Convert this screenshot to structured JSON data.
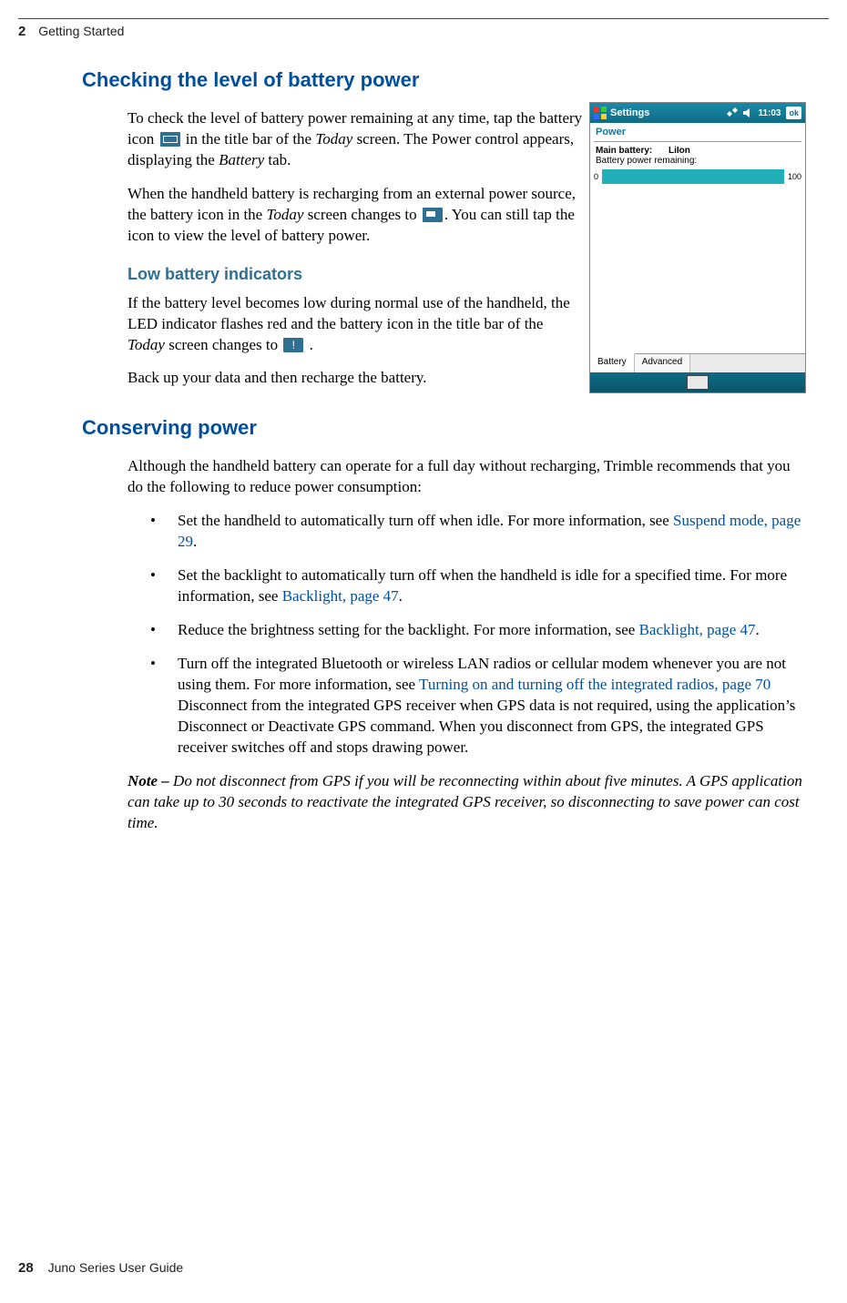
{
  "header": {
    "chapter_number": "2",
    "chapter_title": "Getting Started"
  },
  "section1": {
    "heading": "Checking the level of battery power",
    "p1_a": "To check the level of battery power remaining at any time, tap the battery icon ",
    "p1_b": " in the title bar of the ",
    "p1_today": "Today",
    "p1_c": " screen. The Power control appears, displaying the ",
    "p1_battery": "Battery",
    "p1_d": " tab.",
    "p2_a": "When the handheld battery is recharging from an external power source, the battery icon in the ",
    "p2_today": "Today",
    "p2_b": " screen changes to ",
    "p2_c": ". You can still tap the icon to view the level of battery power.",
    "sub_heading": "Low battery indicators",
    "p3_a": "If the battery level becomes low during normal use of the handheld, the LED indicator flashes red and the battery icon  in the title bar of the ",
    "p3_today": "Today",
    "p3_b": " screen changes to ",
    "p3_c": " .",
    "p4": "Back up your data and then recharge the battery."
  },
  "section2": {
    "heading": "Conserving power",
    "intro": "Although the handheld battery can operate for a full day without recharging, Trimble recommends that you do the following to reduce power consumption:",
    "li1_a": "Set the handheld to automatically turn off when idle. For more information, see ",
    "li1_link": "Suspend mode, page 29",
    "li1_b": ".",
    "li2_a": "Set the backlight to automatically turn off when the handheld is idle for a specified time. For more information, see ",
    "li2_link": "Backlight, page 47",
    "li2_b": ".",
    "li3_a": "Reduce the brightness setting for the backlight. For more information, see ",
    "li3_link": "Backlight, page 47",
    "li3_b": ".",
    "li4_a": "Turn off the integrated Bluetooth or wireless LAN radios or cellular modem whenever you are not using them. For more information, see ",
    "li4_link": "Turning on and turning off the integrated radios, page 70",
    "li4_b": " Disconnect from the integrated GPS receiver when GPS data is not required, using the application’s Disconnect or Deactivate GPS command. When you disconnect from GPS, the integrated GPS receiver switches off and stops drawing power.",
    "note_label": "Note – ",
    "note_body": "Do not disconnect from GPS if you will be reconnecting within about five minutes. A GPS application can take up to 30 seconds to reactivate the integrated GPS receiver, so disconnecting to save power can cost time."
  },
  "screenshot": {
    "title": "Settings",
    "time": "11:03",
    "ok": "ok",
    "power_label": "Power",
    "mb_key": "Main battery:",
    "mb_val": "LiIon",
    "remaining": "Battery power remaining:",
    "zero": "0",
    "hundred": "100",
    "tab_battery": "Battery",
    "tab_advanced": "Advanced"
  },
  "footer": {
    "page": "28",
    "guide": "Juno Series User Guide"
  }
}
